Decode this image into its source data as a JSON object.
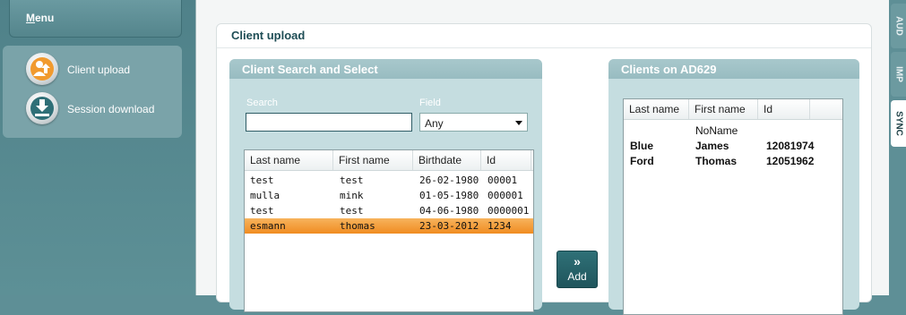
{
  "sidebar": {
    "menu_label": "Menu",
    "items": [
      {
        "label": "Client upload",
        "icon": "client-upload-icon"
      },
      {
        "label": "Session download",
        "icon": "session-download-icon"
      }
    ]
  },
  "main": {
    "title": "Client upload",
    "search_group": {
      "title": "Client Search and Select",
      "search_label": "Search",
      "search_value": "",
      "field_label": "Field",
      "field_value": "Any",
      "columns": [
        "Last name",
        "First name",
        "Birthdate",
        "Id"
      ],
      "rows": [
        [
          "test",
          "test",
          "26-02-1980",
          "00001"
        ],
        [
          "mulla",
          "mink",
          "01-05-1980",
          "000001"
        ],
        [
          "test",
          "test",
          "04-06-1980",
          "0000001"
        ],
        [
          "esmann",
          "thomas",
          "23-03-2012",
          "1234"
        ]
      ],
      "selected_row": 3
    },
    "add_button": {
      "label": "Add",
      "icon": "double-chevron-right-icon"
    },
    "clients_group": {
      "title": "Clients on AD629",
      "columns": [
        "Last name",
        "First name",
        "Id"
      ],
      "rows": [
        [
          "",
          "NoName",
          ""
        ],
        [
          "Blue",
          "James",
          "12081974"
        ],
        [
          "Ford",
          "Thomas",
          "12051962"
        ]
      ]
    }
  },
  "tabs": [
    {
      "label": "AUD",
      "active": false
    },
    {
      "label": "IMP",
      "active": false
    },
    {
      "label": "SYNC",
      "active": true
    }
  ],
  "colors": {
    "accent": "#1f555c",
    "selection": "#f08c21",
    "sidebar": "#5e8f96"
  }
}
